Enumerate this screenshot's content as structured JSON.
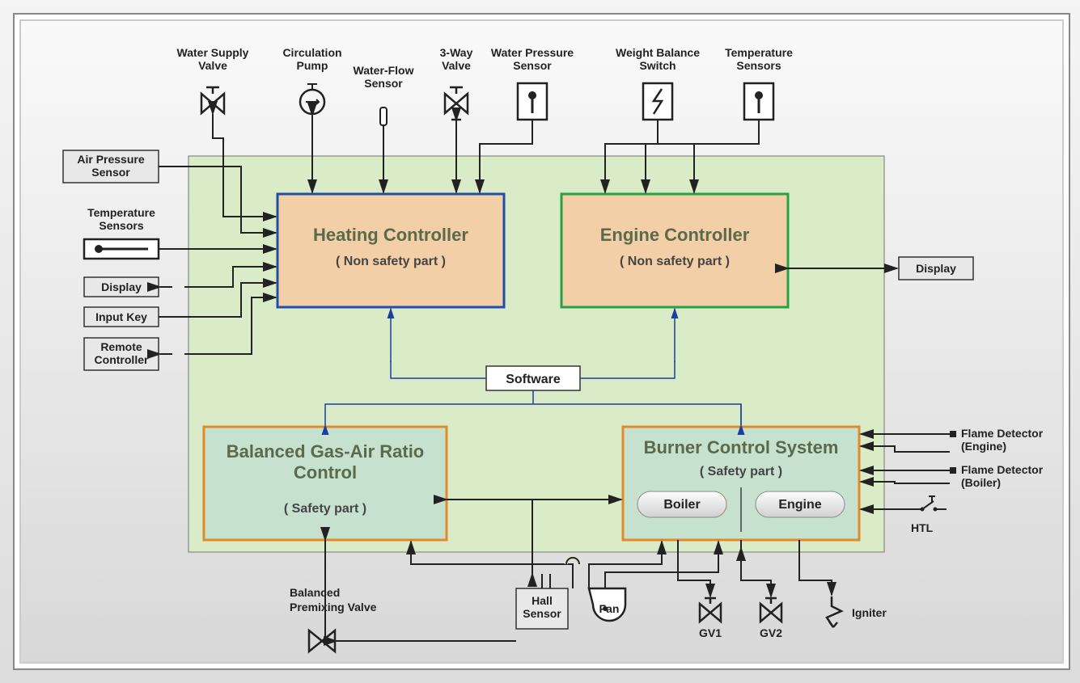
{
  "topLabels": {
    "waterSupplyValve": "Water Supply\nValve",
    "circulationPump": "Circulation\nPump",
    "waterFlowSensor": "Water-Flow\nSensor",
    "threeWayValve": "3-Way\nValve",
    "waterPressureSensor": "Water Pressure\nSensor",
    "weightBalanceSwitch": "Weight Balance\nSwitch",
    "temperatureSensors": "Temperature\nSensors"
  },
  "leftBoxes": {
    "airPressureSensor": "Air Pressure\nSensor",
    "temperatureSensors": "Temperature\nSensors",
    "display": "Display",
    "inputKey": "Input Key",
    "remoteController": "Remote\nController"
  },
  "rightBoxes": {
    "display": "Display",
    "flameDetectorEngine": "Flame Detector\n(Engine)",
    "flameDetectorBoiler": "Flame Detector\n(Boiler)",
    "htl": "HTL",
    "igniter": "Igniter"
  },
  "controllers": {
    "heating": {
      "title": "Heating Controller",
      "subtitle": "( Non safety part )"
    },
    "engine": {
      "title": "Engine Controller",
      "subtitle": "( Non safety part )"
    },
    "gasAir": {
      "title": "Balanced Gas-Air Ratio\nControl",
      "subtitle": "( Safety part )"
    },
    "burner": {
      "title": "Burner Control System",
      "subtitle": "( Safety part )",
      "pill1": "Boiler",
      "pill2": "Engine"
    }
  },
  "center": {
    "software": "Software"
  },
  "bottom": {
    "balancedPremixingValve": "Balanced\nPremixing Valve",
    "hallSensor": "Hall\nSensor",
    "fan": "Fan",
    "gv1": "GV1",
    "gv2": "GV2"
  }
}
